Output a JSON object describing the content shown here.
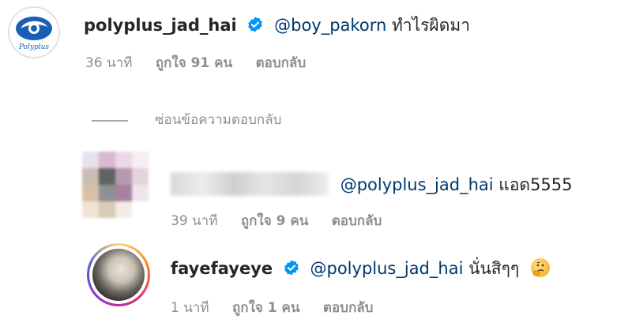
{
  "comments": [
    {
      "username": "polyplus_jad_hai",
      "verified": true,
      "mention": "@boy_pakorn",
      "text": "ทำไรผิดมา",
      "time": "36 นาที",
      "likes": "ถูกใจ 91 คน",
      "reply": "ตอบกลับ",
      "avatar_logo_text": "Polyplus",
      "brand_color": "#1a5fb4"
    },
    {
      "hide_replies": "ซ่อนข้อความตอบกลับ"
    },
    {
      "username_blurred": true,
      "mention": "@polyplus_jad_hai",
      "text": "แอด5555",
      "time": "39 นาที",
      "likes": "ถูกใจ 9 คน",
      "reply": "ตอบกลับ"
    },
    {
      "username": "fayefayeye",
      "verified": true,
      "mention": "@polyplus_jad_hai",
      "text": "นั่นสิๆๆ",
      "emoji": "thinking-face-icon",
      "time": "1 นาที",
      "likes": "ถูกใจ 1 คน",
      "reply": "ตอบกลับ"
    }
  ],
  "colors": {
    "verified_badge": "#0095f6",
    "mention": "#00376b",
    "meta": "#8e8e8e"
  }
}
